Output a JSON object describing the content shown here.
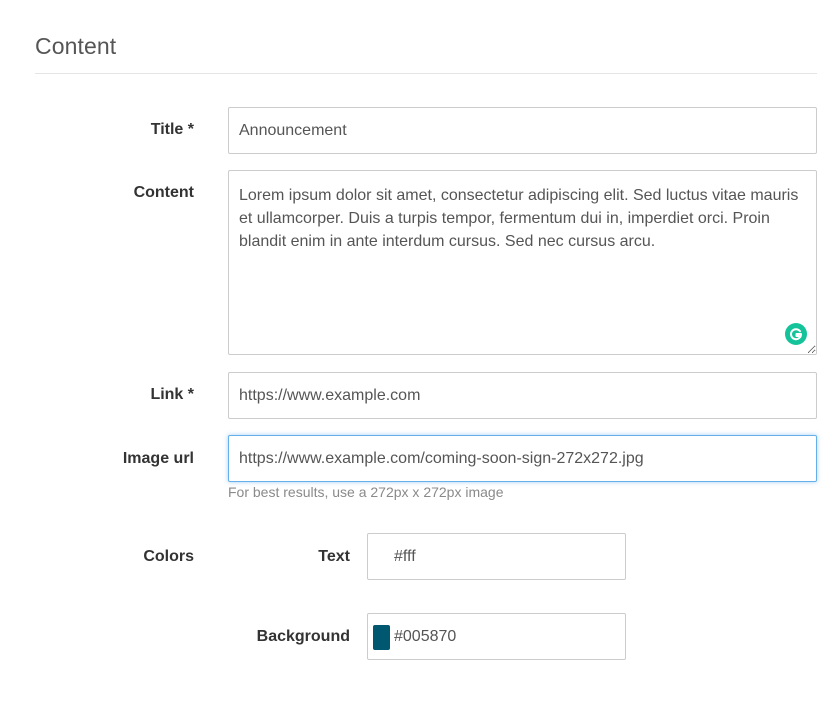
{
  "section": {
    "title": "Content"
  },
  "form": {
    "title": {
      "label": "Title *",
      "value": "Announcement"
    },
    "content": {
      "label": "Content",
      "value": "Lorem ipsum dolor sit amet, consectetur adipiscing elit. Sed luctus vitae mauris et ullamcorper. Duis a turpis tempor, fermentum dui in, imperdiet orci. Proin blandit enim in ante interdum cursus. Sed nec cursus arcu."
    },
    "link": {
      "label": "Link *",
      "value": "https://www.example.com"
    },
    "image_url": {
      "label": "Image url",
      "value": "https://www.example.com/coming-soon-sign-272x272.jpg",
      "help": "For best results, use a 272px x 272px image"
    },
    "colors": {
      "label": "Colors",
      "text": {
        "label": "Text",
        "value": "#fff",
        "swatch": "#ffffff"
      },
      "background": {
        "label": "Background",
        "value": "#005870",
        "swatch": "#005870"
      }
    }
  },
  "icons": {
    "grammarly": "grammarly-icon"
  },
  "theme": {
    "focus_border": "#66afe9",
    "grammarly_green": "#15c39a"
  }
}
